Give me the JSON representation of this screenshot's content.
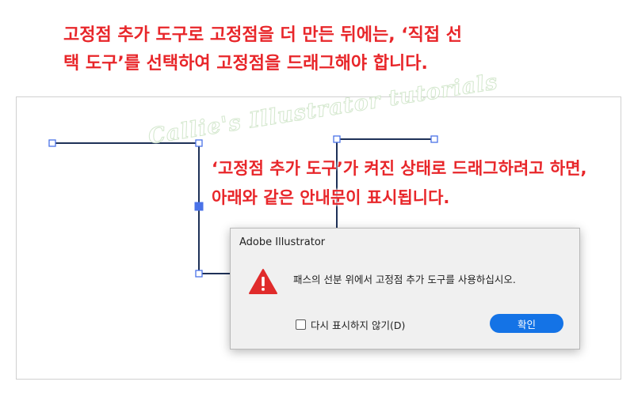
{
  "captions": {
    "top_line1": "고정점 추가 도구로 고정점을 더 만든 뒤에는, ‘직접 선",
    "top_line2": "택 도구’를 선택하여 고정점을 드래그해야 합니다.",
    "mid_line1": "‘고정점 추가 도구’가 켜진 상태로 드래그하려고 하면,",
    "mid_line2": "아래와 같은 안내문이 표시됩니다."
  },
  "watermark": "Callie's Illustrator tutorials",
  "dialog": {
    "title": "Adobe Illustrator",
    "icon": "warning-icon",
    "message": "패스의 선분 위에서 고정점 추가 도구를 사용하십시오.",
    "checkbox_label": "다시 표시하지 않기(D)",
    "checkbox_checked": false,
    "ok_label": "확인"
  },
  "colors": {
    "caption_red": "#e8262a",
    "path_stroke": "#1e3158",
    "anchor_blue": "#4a72e8",
    "button_blue": "#1473e6",
    "warning_red": "#e02b2b"
  }
}
